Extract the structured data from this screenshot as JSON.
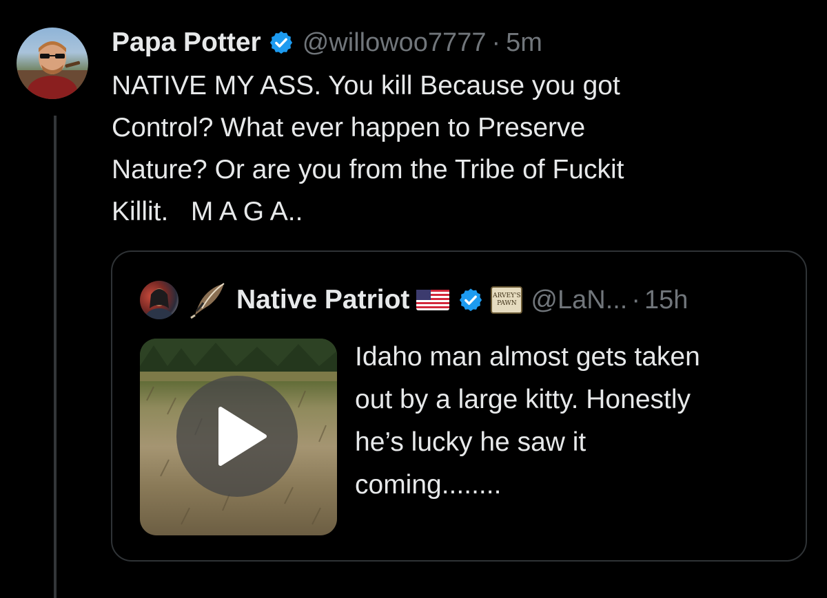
{
  "author": {
    "display_name": "Papa Potter",
    "handle": "@willowoo7777",
    "separator": "·",
    "time": "5m"
  },
  "tweet": {
    "text": "NATIVE MY ASS. You kill Because you got\nControl? What ever happen to Preserve\nNature? Or are you from the Tribe of Fuckit\nKillit.   M A G A.."
  },
  "quote": {
    "display_name": "Native Patriot",
    "handle": "@LaN...",
    "separator": "·",
    "time": "15h",
    "affiliate_badge_text": [
      "ARVEY'S",
      "PAWN"
    ],
    "text": "Idaho man almost gets taken\nout by a large kitty. Honestly\nhe’s lucky he saw it\ncoming........",
    "media": {
      "type": "video",
      "icon": "play-icon"
    }
  },
  "icons": {
    "verified": "verified-badge-icon",
    "feather": "feather-icon",
    "flag": "us-flag-icon",
    "play": "play-icon"
  },
  "colors": {
    "background": "#000000",
    "text_primary": "#e7e9ea",
    "text_secondary": "#71767b",
    "verified_blue": "#1d9bf0",
    "border": "#2f3336"
  }
}
